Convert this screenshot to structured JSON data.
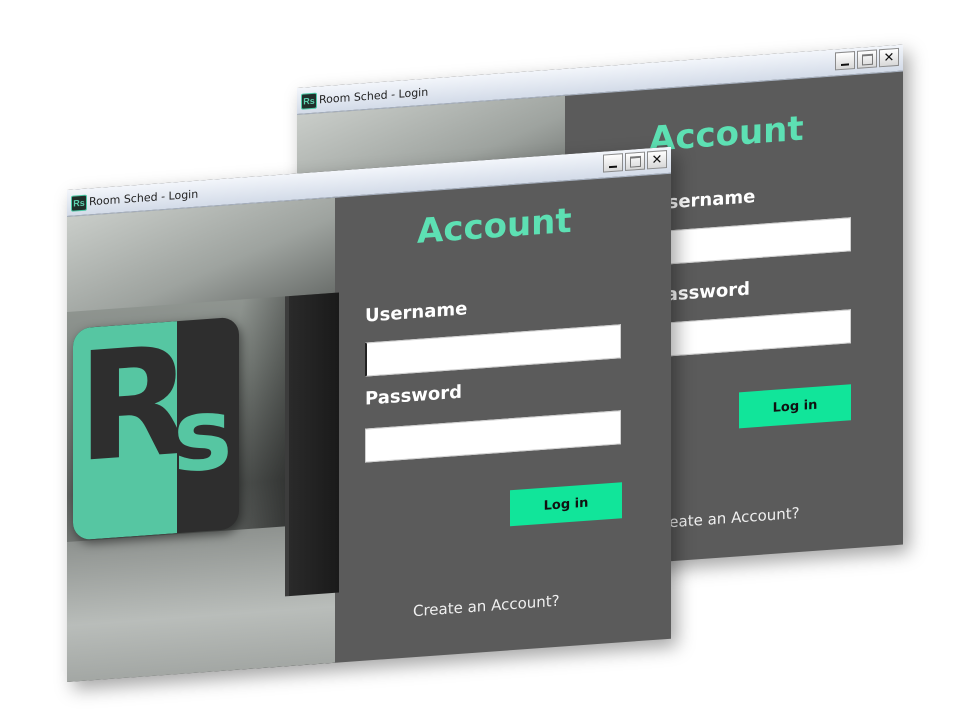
{
  "window": {
    "title": "Room Sched - Login",
    "app_icon_text": "Rs",
    "controls": {
      "close": "✕"
    }
  },
  "login_form": {
    "heading": "Account",
    "username_label": "Username",
    "username_value": "",
    "password_label": "Password",
    "password_value": "",
    "login_button": "Log in",
    "create_account_link": "Create an Account?"
  },
  "logo": {
    "letter_main": "R",
    "letter_small": "s"
  },
  "colors": {
    "accent": "#5de0b3",
    "button": "#11e59a",
    "panel_bg": "#5b5b5b",
    "logo_mint": "#56c6a2"
  }
}
